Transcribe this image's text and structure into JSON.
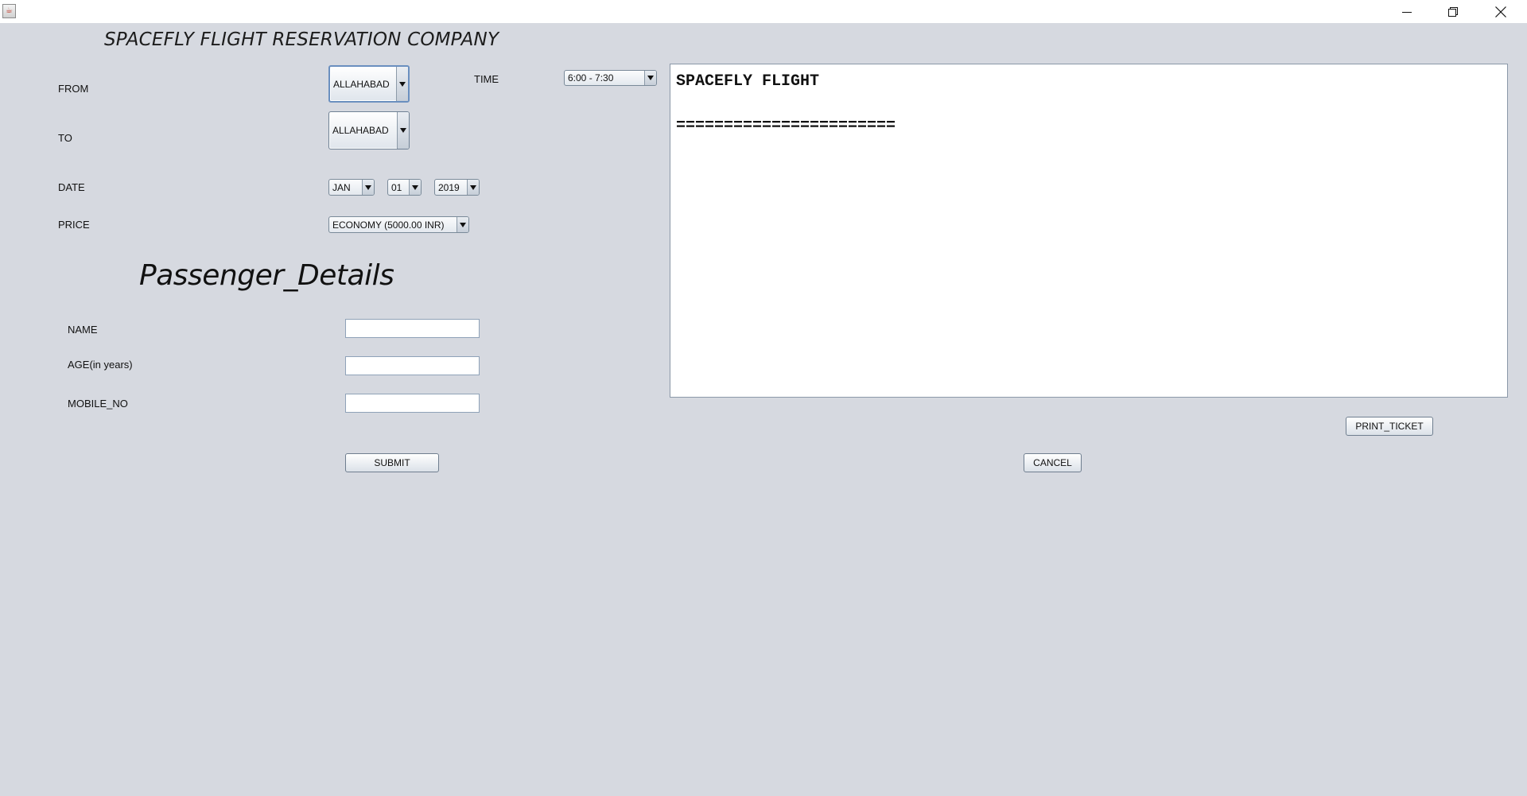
{
  "window": {
    "app_icon": "java-cup-icon",
    "controls": [
      "minimize-icon",
      "maximize-icon",
      "close-icon"
    ]
  },
  "company_title": "SPACEFLY FLIGHT RESERVATION COMPANY",
  "labels": {
    "from": "FROM",
    "to": "TO",
    "time": "TIME",
    "date": "DATE",
    "price": "PRICE",
    "name": "NAME",
    "age": "AGE(in years)",
    "mobile": "MOBILE_NO"
  },
  "selects": {
    "from": "ALLAHABAD",
    "to": "ALLAHABAD",
    "time": "6:00 - 7:30",
    "month": "JAN",
    "day": "01",
    "year": "2019",
    "price": "ECONOMY (5000.00 INR)"
  },
  "passenger_title": "Passenger_Details",
  "inputs": {
    "name": "",
    "age": "",
    "mobile": ""
  },
  "buttons": {
    "submit": "SUBMIT",
    "cancel": "CANCEL",
    "print": "PRINT_TICKET"
  },
  "ticket": {
    "line1": "SPACEFLY FLIGHT",
    "line2": "",
    "line3": "======================="
  }
}
